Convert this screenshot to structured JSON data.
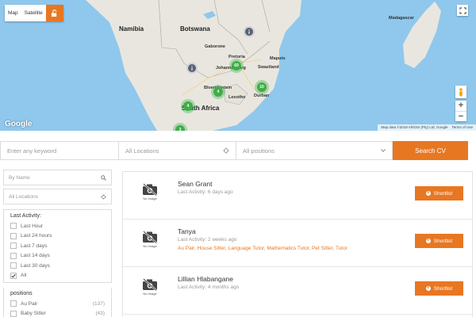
{
  "map": {
    "type_map": "Map",
    "type_satellite": "Satellite",
    "labels": {
      "namibia": "Namibia",
      "botswana": "Botswana",
      "gaborone": "Gaborone",
      "pretoria": "Pretoria",
      "johannesburg": "Johannesburg",
      "maputo": "Maputo",
      "swaziland": "Swaziland",
      "bloemfontein": "Bloemfontein",
      "lesotho": "Lesotho",
      "durban": "Durban",
      "south_africa": "South Africa",
      "madagascar": "Madagascar"
    },
    "clusters": [
      "69",
      "10",
      "4",
      "4",
      "3"
    ],
    "google": "Google",
    "attribution": [
      "Map data ©2019 AfriGIS (Pty) Ltd, Google",
      "Terms of Use"
    ],
    "zoom_in": "+",
    "zoom_out": "−"
  },
  "search": {
    "keyword_placeholder": "Enter any keyword",
    "location_value": "All Locations",
    "positions_value": "All positions",
    "button": "Search CV"
  },
  "sidebar": {
    "name_placeholder": "By Name",
    "location_value": "All Locations",
    "last_activity": {
      "title": "Last Activity:",
      "options": [
        {
          "label": "Last Hour",
          "checked": false
        },
        {
          "label": "Last 24 hours",
          "checked": false
        },
        {
          "label": "Last 7 days",
          "checked": false
        },
        {
          "label": "Last 14 days",
          "checked": false
        },
        {
          "label": "Last 30 days",
          "checked": false
        },
        {
          "label": "All",
          "checked": true
        }
      ]
    },
    "positions": {
      "title": "positions",
      "options": [
        {
          "label": "Au Pair",
          "count": "(137)"
        },
        {
          "label": "Baby Sitter",
          "count": "(43)"
        }
      ]
    }
  },
  "results": [
    {
      "no_image": "No Image",
      "name": "Sean Grant",
      "activity": "Last Activity: 6 days ago",
      "tags": "",
      "button": "Shortlist"
    },
    {
      "no_image": "No Image",
      "name": "Tanya",
      "activity": "Last Activity: 2 weeks ago",
      "tags": "Au Pair, House Sitter, Language Tutor, Mathematics Tutor, Pet Sitter, Tutor",
      "button": "Shortlist"
    },
    {
      "no_image": "No Image",
      "name": "Lillian Hlabangane",
      "activity": "Last Activity: 4 months ago",
      "tags": "",
      "button": "Shortlist"
    }
  ],
  "colors": {
    "accent": "#e87722",
    "water": "#8fc8ec",
    "land": "#e9e6df",
    "cluster": "#3fae47"
  }
}
